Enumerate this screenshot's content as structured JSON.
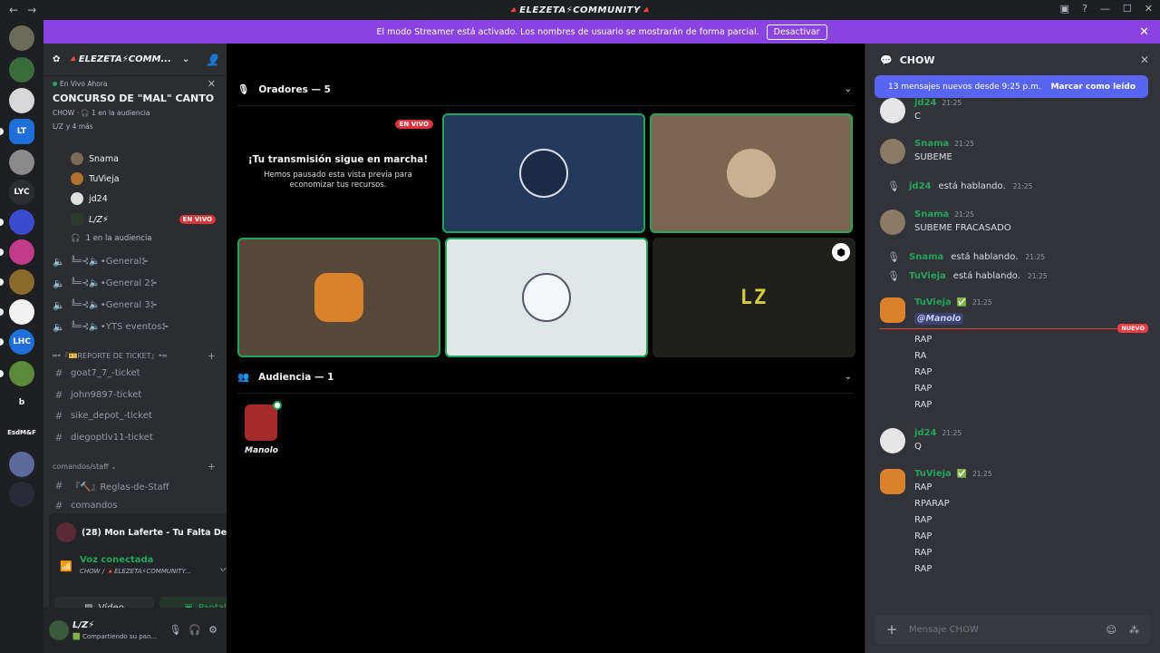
{
  "window": {
    "title": "🔺ELEZETA⚡COMMUNITY🔺",
    "nav_back": "←",
    "nav_fwd": "→"
  },
  "banner": {
    "text": "El modo Streamer está activado. Los nombres de usuario se mostrarán de forma parcial.",
    "button": "Desactivar"
  },
  "rail": {
    "servers": [
      {
        "label": "",
        "color": "#6b6b5a"
      },
      {
        "label": "",
        "color": "#3a6b3a"
      },
      {
        "label": "",
        "color": "#d8d8d8"
      },
      {
        "label": "LT",
        "color": "#1e6fd9"
      },
      {
        "label": "",
        "color": "#8a8a8a"
      },
      {
        "label": "LYC",
        "color": "#2b2d31"
      },
      {
        "label": "",
        "color": "#3b4bd0"
      },
      {
        "label": "",
        "color": "#c23a8a"
      },
      {
        "label": "",
        "color": "#8a6a2a"
      },
      {
        "label": "",
        "color": "#f2f2f2"
      },
      {
        "label": "LHC",
        "color": "#1e6fd9"
      },
      {
        "label": "",
        "color": "#5a8a3a"
      },
      {
        "label": "b",
        "color": "#1e1f22"
      },
      {
        "label": "EsdM&F",
        "color": "#1e1f22"
      },
      {
        "label": "",
        "color": "#5a6a9a"
      },
      {
        "label": "",
        "color": "#2a2a3a"
      }
    ]
  },
  "sidebar": {
    "guild_name": "🔺ELEZETA⚡COMM...",
    "live": {
      "badge": "En Vivo Ahora",
      "title": "CONCURSO DE \"MAL\" CANTO",
      "channel": "CHOW",
      "audience": "1 en la audiencia",
      "users": "L/Z",
      "more": "y 4 más"
    },
    "voice_users": [
      {
        "name": "Snama",
        "color": "#7a6a5a"
      },
      {
        "name": "TuVieja",
        "color": "#b07030"
      },
      {
        "name": "jd24",
        "color": "#e0e0e0"
      },
      {
        "name": "L/Z⚡",
        "color": "#2b3a2b",
        "live": "EN VIVO"
      }
    ],
    "audience_row": "1 en la audiencia",
    "voice_channels": [
      "╚═⊰🔈•General⊱",
      "╚═⊰🔈•General 2⊱",
      "╚═⊰🔈•General 3⊱",
      "╚═⊰🔈•YTS eventos⊱"
    ],
    "ticket_category": "═•『🎫REPORTE DE TICKET』•═",
    "ticket_channels": [
      "goat7_7_-ticket",
      "john9897-ticket",
      "sike_depot_-ticket",
      "diegoptlv11-ticket"
    ],
    "staff_category": "comandos/staff",
    "staff_channels": [
      "『🔨』Reglas-de-Staff",
      "comandos"
    ]
  },
  "nowplaying": {
    "song": "(28) Mon Laferte - Tu Falta De Quer...",
    "voice_status": "Voz conectada",
    "voice_channel": "CHOW / 🔺ELEZETA⚡COMMUNITY...",
    "video": "Vídeo",
    "screen": "Pantalla"
  },
  "user": {
    "name": "L/Z⚡",
    "status": "🟩 Compartiendo su pan..."
  },
  "stage": {
    "speakers_title": "Oradores — 5",
    "paused_title": "¡Tu transmisión sigue en marcha!",
    "paused_text": "Hemos pausado esta vista previa para economizar tus recursos.",
    "live_tag": "EN VIVO",
    "lz_logo": "LZ",
    "audience_title": "Audiencia — 1",
    "audience_member": "Manolo"
  },
  "chat": {
    "channel": "CHOW",
    "new_messages": "13 mensajes nuevos desde 9:25 p.m.",
    "mark_read": "Marcar como leído",
    "placeholder": "Mensaje CHOW",
    "new_label": "NUEVO",
    "messages": [
      {
        "user": "jd24",
        "time": "21:25",
        "text": "C"
      },
      {
        "user": "Snama",
        "time": "21:25",
        "text": "SUBEME"
      },
      {
        "sys_user": "jd24",
        "sys_text": "está hablando.",
        "time": "21:25"
      },
      {
        "user": "Snama",
        "time": "21:25",
        "text": "SUBEME FRACASADO"
      },
      {
        "sys_user": "Snama",
        "sys_text": "está hablando.",
        "time": "21:25"
      },
      {
        "sys_user": "TuVieja",
        "sys_text": "está hablando.",
        "time": "21:25"
      },
      {
        "user": "TuVieja",
        "time": "21:25",
        "mention": "@Manolo",
        "lines": [
          "RAP",
          "RA",
          "RAP",
          "RAP",
          "RAP"
        ]
      },
      {
        "user": "jd24",
        "time": "21:25",
        "text": "Q"
      },
      {
        "user": "TuVieja",
        "time": "21:25",
        "lines": [
          "RAP",
          "RPARAP",
          "RAP",
          "RAP",
          "RAP",
          "RAP"
        ]
      }
    ]
  },
  "colors": {
    "accent": "#5865f2",
    "banner": "#8a43e0",
    "online": "#23a55a",
    "live": "#da373c"
  }
}
